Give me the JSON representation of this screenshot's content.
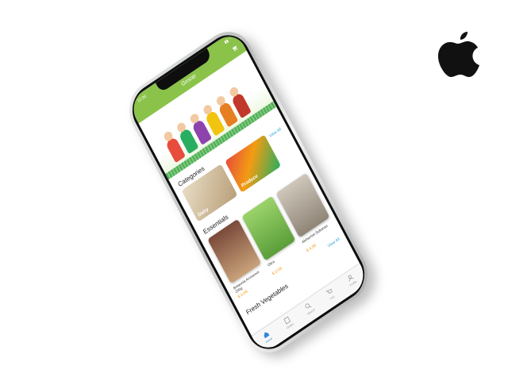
{
  "brand": {
    "logo_icon": "apple-logo-icon"
  },
  "status": {
    "time": "12:00",
    "icons": "▮▮ ◔"
  },
  "app": {
    "title": "Grocer"
  },
  "banner": {
    "text": ""
  },
  "categories": {
    "title": "Categories",
    "view_all": "View All",
    "items": [
      {
        "label": "Dairy"
      },
      {
        "label": "Produce"
      }
    ]
  },
  "essentials": {
    "title": "Essentials",
    "view_all": "View All",
    "items": [
      {
        "name": "Britannia Arrowroot 250g",
        "price": "$ 0.99"
      },
      {
        "name": "Okra",
        "price": "$ 3.59"
      },
      {
        "name": "Alchemist Sultanas",
        "price": "$ 4.99"
      }
    ]
  },
  "fresh": {
    "title": "Fresh Vegetables"
  },
  "tabs": [
    {
      "label": "Home",
      "icon": "home-icon",
      "active": true
    },
    {
      "label": "Orders",
      "icon": "orders-icon",
      "active": false
    },
    {
      "label": "Search",
      "icon": "search-icon",
      "active": false
    },
    {
      "label": "Cart",
      "icon": "cart-icon",
      "active": false
    },
    {
      "label": "Profile",
      "icon": "profile-icon",
      "active": false
    }
  ],
  "colors": {
    "accent": "#8bc34a",
    "price": "#f39c12",
    "link": "#29a3d6",
    "active_tab": "#2e86de"
  }
}
